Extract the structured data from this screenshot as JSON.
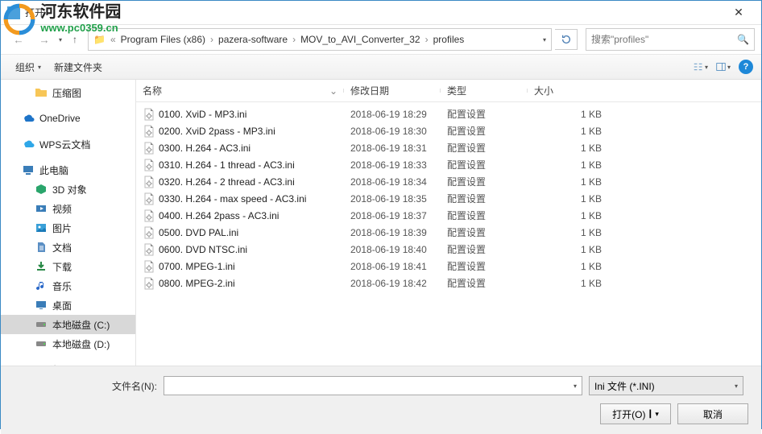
{
  "watermark": {
    "title": "河东软件园",
    "url": "www.pc0359.cn"
  },
  "window": {
    "title": "打开"
  },
  "breadcrumb": {
    "items": [
      "Program Files (x86)",
      "pazera-software",
      "MOV_to_AVI_Converter_32",
      "profiles"
    ]
  },
  "search": {
    "placeholder": "搜索\"profiles\""
  },
  "toolbar": {
    "organize": "组织",
    "newfolder": "新建文件夹"
  },
  "columns": {
    "name": "名称",
    "date": "修改日期",
    "type": "类型",
    "size": "大小"
  },
  "sidebar": {
    "items": [
      {
        "label": "压缩图",
        "icon": "folder",
        "level": 2
      },
      {
        "label": "OneDrive",
        "icon": "onedrive",
        "level": 1
      },
      {
        "label": "WPS云文档",
        "icon": "wps",
        "level": 1
      },
      {
        "label": "此电脑",
        "icon": "pc",
        "level": 1
      },
      {
        "label": "3D 对象",
        "icon": "3d",
        "level": 2
      },
      {
        "label": "视频",
        "icon": "video",
        "level": 2
      },
      {
        "label": "图片",
        "icon": "pictures",
        "level": 2
      },
      {
        "label": "文档",
        "icon": "docs",
        "level": 2
      },
      {
        "label": "下载",
        "icon": "download",
        "level": 2
      },
      {
        "label": "音乐",
        "icon": "music",
        "level": 2
      },
      {
        "label": "桌面",
        "icon": "desktop",
        "level": 2
      },
      {
        "label": "本地磁盘 (C:)",
        "icon": "disk",
        "level": 2,
        "selected": true
      },
      {
        "label": "本地磁盘 (D:)",
        "icon": "disk",
        "level": 2
      },
      {
        "label": "网络",
        "icon": "network",
        "level": 1
      }
    ]
  },
  "files": [
    {
      "name": "0100. XviD - MP3.ini",
      "date": "2018-06-19 18:29",
      "type": "配置设置",
      "size": "1 KB"
    },
    {
      "name": "0200. XviD 2pass - MP3.ini",
      "date": "2018-06-19 18:30",
      "type": "配置设置",
      "size": "1 KB"
    },
    {
      "name": "0300. H.264 - AC3.ini",
      "date": "2018-06-19 18:31",
      "type": "配置设置",
      "size": "1 KB"
    },
    {
      "name": "0310. H.264 - 1 thread - AC3.ini",
      "date": "2018-06-19 18:33",
      "type": "配置设置",
      "size": "1 KB"
    },
    {
      "name": "0320. H.264 - 2 thread - AC3.ini",
      "date": "2018-06-19 18:34",
      "type": "配置设置",
      "size": "1 KB"
    },
    {
      "name": "0330. H.264 - max speed - AC3.ini",
      "date": "2018-06-19 18:35",
      "type": "配置设置",
      "size": "1 KB"
    },
    {
      "name": "0400. H.264 2pass - AC3.ini",
      "date": "2018-06-19 18:37",
      "type": "配置设置",
      "size": "1 KB"
    },
    {
      "name": "0500. DVD PAL.ini",
      "date": "2018-06-19 18:39",
      "type": "配置设置",
      "size": "1 KB"
    },
    {
      "name": "0600. DVD NTSC.ini",
      "date": "2018-06-19 18:40",
      "type": "配置设置",
      "size": "1 KB"
    },
    {
      "name": "0700. MPEG-1.ini",
      "date": "2018-06-19 18:41",
      "type": "配置设置",
      "size": "1 KB"
    },
    {
      "name": "0800. MPEG-2.ini",
      "date": "2018-06-19 18:42",
      "type": "配置设置",
      "size": "1 KB"
    }
  ],
  "bottom": {
    "filename_label": "文件名(N):",
    "filename_value": "",
    "filetype": "Ini 文件 (*.INI)",
    "open": "打开(O)",
    "cancel": "取消"
  }
}
